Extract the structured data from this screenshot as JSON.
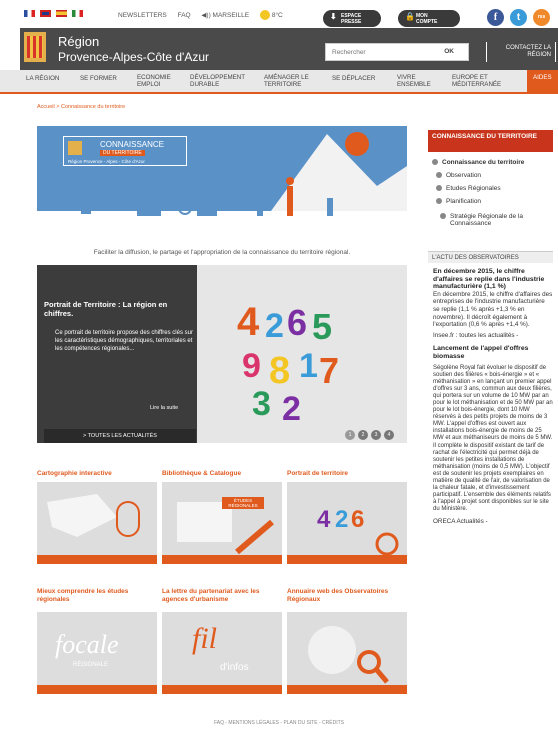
{
  "top": {
    "links": [
      "NEWSLETTERS",
      "FAQ",
      "◀)) MARSEILLE",
      "8°C"
    ],
    "espace_presse": [
      "ESPACE",
      "PRESSE"
    ],
    "mon_compte": [
      "MON",
      "COMPTE"
    ],
    "social": [
      "f",
      "t",
      "rss"
    ]
  },
  "header": {
    "title_line1": "Région",
    "title_line2": "Provence-Alpes-Côte d'Azur",
    "search_placeholder": "Rechercher",
    "search_ok": "OK",
    "contact": [
      "CONTACTEZ LA",
      "RÉGION"
    ]
  },
  "nav": {
    "items": [
      "LA RÉGION",
      "SE FORMER",
      "ECONOMIE EMPLOI",
      "DÉVELOPPEMENT DURABLE",
      "AMÉNAGER LE TERRITOIRE",
      "SE DÉPLACER",
      "VIVRE ENSEMBLE",
      "EUROPE ET MÉDITERRANÉE",
      "AIDES"
    ]
  },
  "breadcrumb": "Accueil > Connaissance du territoire",
  "hero": {
    "badge_line1": "CONNAISSANCE",
    "badge_line2": "DU TERRITOIRE",
    "badge_sub": "Région Provence - Alpes - Côte d'Azur",
    "caption": "Faciliter la diffusion, le partage et l'appropriation de la connaissance du territoire régional."
  },
  "slider": {
    "title": "Portrait de Territoire : La région en chiffres.",
    "text": "Ce portrait de territoire propose des chiffres clés sur les caractéristiques démographiques, territoriales et les compétences régionales...",
    "more": "Lire la suite",
    "all_news": "> TOUTES LES ACTUALITÉS",
    "pages": [
      "1",
      "2",
      "3",
      "4"
    ]
  },
  "grid": [
    {
      "title": "Cartographie interactive"
    },
    {
      "title": "Bibliothèque & Catalogue",
      "badge": "ÉTUDES RÉGIONALES"
    },
    {
      "title": "Portrait de territoire"
    },
    {
      "title": "Mieux comprendre les études régionales",
      "art": "focale",
      "art_sub": "RÉGIONALE"
    },
    {
      "title": "La lettre du partenariat avec les agences d'urbanisme",
      "art": "fil",
      "art_sub": "d'infos"
    },
    {
      "title": "Annuaire web des Observatoires Régionaux"
    }
  ],
  "sidebar": {
    "heading": "CONNAISSANCE DU TERRITOIRE",
    "items": [
      "Connaissance du territoire",
      "Observation",
      "Etudes Régionales",
      "Planification",
      "Stratégie Régionale de la Connaissance"
    ]
  },
  "news": {
    "heading": "L'ACTU DES OBSERVATOIRES",
    "item1_title": "En décembre 2015, le chiffre d'affaires se replie dans l'industrie manufacturière (1,1 %)",
    "item1_text": "En décembre 2015, le chiffre d'affaires des entreprises de l'industrie manufacturière se replie (1,1 % après +1,3 % en novembre). Il décroît également à l'exportation (0,6 % après +1,4 %).",
    "item1_src": "Insee.fr : toutes les actualités -",
    "item2_title": "Lancement de l'appel d'offres biomasse",
    "item2_text": "Ségolène Royal fait évoluer le dispositif de soutien des filières « bois-énergie » et « méthanisation » en lançant un premier appel d'offres sur 3 ans, commun aux deux filières, qui portera sur un volume de 10 MW par an pour le lot méthanisation et de 50 MW par an pour le lot bois-énergie, dont 10 MW réservés à des petits projets de moins de 3 MW. L'appel d'offres est ouvert aux installations bois-énergie de moins de 25 MW et aux méthaniseurs de moins de 5 MW. Il complète le dispositif existant de tarif de rachat de l'électricité qui permet déjà de soutenir les petites installations de méthanisation (moins de 0,5 MW). L'objectif est de soutenir les projets exemplaires en matière de qualité de l'air, de valorisation de la chaleur fatale, et d'investissement participatif. L'ensemble des éléments relatifs à l'appel à projet sont disponibles sur le site du Ministère.",
    "item2_src": "ORECA Actualités -"
  },
  "footer": "FAQ - MENTIONS LÉGALES - PLAN DU SITE - CRÉDITS",
  "colors": {
    "accent": "#e05a1e",
    "header": "#4a4a4a",
    "sidebar_head": "#c8351c",
    "hero_sky": "#5a92c8"
  }
}
